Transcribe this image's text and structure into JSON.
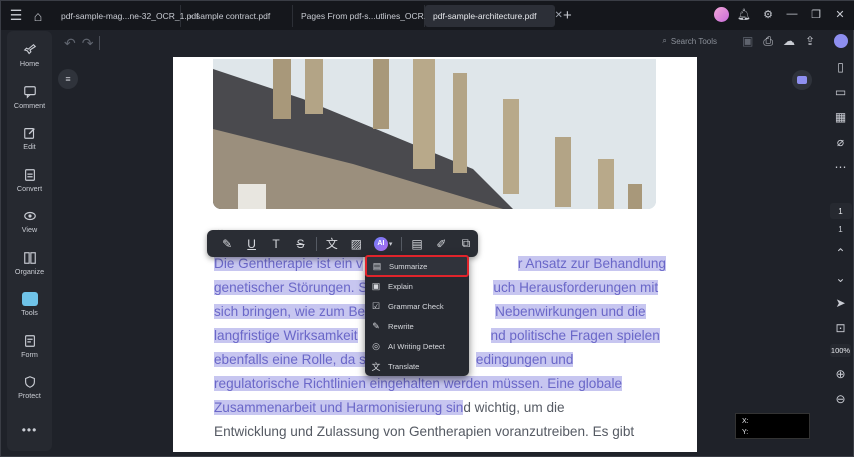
{
  "tabs": [
    {
      "label": "pdf-sample-mag...ne-32_OCR_1.pdf",
      "active": false
    },
    {
      "label": "sample contract.pdf",
      "active": false
    },
    {
      "label": "Pages From pdf-s...utlines_OCR.pdf",
      "active": false
    },
    {
      "label": "pdf-sample-architecture.pdf",
      "active": true
    }
  ],
  "leftnav": [
    {
      "label": "Home",
      "icon": "rocket-icon"
    },
    {
      "label": "Comment",
      "icon": "comment-icon"
    },
    {
      "label": "Edit",
      "icon": "edit-icon"
    },
    {
      "label": "Convert",
      "icon": "convert-icon"
    },
    {
      "label": "View",
      "icon": "eye-icon"
    },
    {
      "label": "Organize",
      "icon": "organize-icon"
    },
    {
      "label": "Tools",
      "icon": "tools-icon"
    },
    {
      "label": "Form",
      "icon": "form-icon"
    },
    {
      "label": "Protect",
      "icon": "shield-icon"
    }
  ],
  "search_tools": "Search Tools",
  "document": {
    "paragraph_lines": [
      {
        "hl": "Die Gentherapie ist ein v",
        "rest": "",
        "hl2": "r Ansatz zur Behandlung"
      },
      {
        "hl": "genetischer Störungen. S",
        "rest": "",
        "hl2": "uch Herausforderungen mit"
      },
      {
        "hl": "sich bringen, wie zum Be",
        "rest": "",
        "hl2": "Nebenwirkungen und die"
      },
      {
        "hl": "langfristige Wirksamkeit",
        "rest": "",
        "hl2": "nd politische Fragen spielen"
      },
      {
        "hl": "ebenfalls eine Rolle, da s",
        "rest": "",
        "hl2": "edingungen und"
      },
      {
        "hl": "regulatorische Richtlinien eingehalten werden müssen. Eine globale",
        "rest": "",
        "hl2": ""
      },
      {
        "hl": "Zusammenarbeit und Harmonisierung sin",
        "rest": "d wichtig, um die",
        "hl2": ""
      },
      {
        "hl": "",
        "rest": "Entwicklung und Zulassung von Gentherapien voranzutreiben. Es gibt",
        "hl2": ""
      }
    ]
  },
  "ai_menu": [
    {
      "label": "Summarize",
      "icon": "summarize-icon"
    },
    {
      "label": "Explain",
      "icon": "explain-icon"
    },
    {
      "label": "Grammar Check",
      "icon": "grammar-check-icon"
    },
    {
      "label": "Rewrite",
      "icon": "rewrite-icon"
    },
    {
      "label": "AI Writing Detect",
      "icon": "ai-detect-icon"
    },
    {
      "label": "Translate",
      "icon": "translate-icon"
    }
  ],
  "ai_badge": "AI",
  "page_number": "1",
  "page_total": "1",
  "zoom": "100%",
  "coords": {
    "x": "X:",
    "y": "Y:"
  },
  "colors": {
    "highlight": "#c7c6f0",
    "accent": "#8e8ff0",
    "menu_outline": "#e0242b"
  }
}
